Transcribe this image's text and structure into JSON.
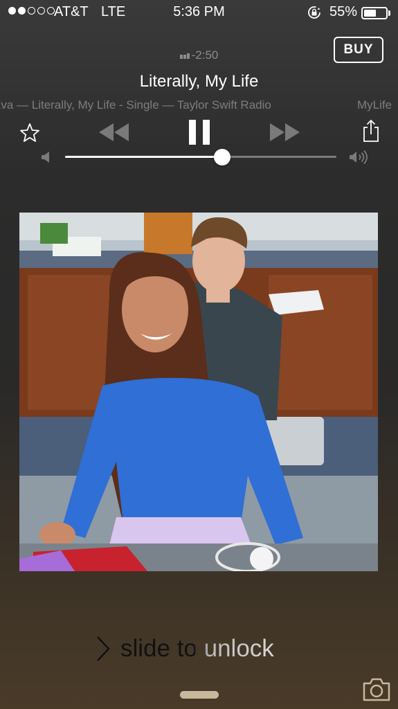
{
  "status_bar": {
    "signal_filled": 2,
    "signal_total": 5,
    "carrier": "AT&T",
    "network": "LTE",
    "time": "5:36 PM",
    "battery_percent_text": "55%",
    "battery_level": 0.55,
    "icons": [
      "orientation-lock-icon"
    ]
  },
  "now_playing": {
    "buy_label": "BUY",
    "time_remaining": "-2:50",
    "title": "Literally, My Life",
    "subtitle": "Eva — Literally, My Life - Single — Taylor Swift Radio",
    "subtitle_tail": "MyLife",
    "volume_level": 0.58
  },
  "controls": {
    "icons": [
      "star-icon",
      "rewind-icon",
      "pause-icon",
      "fast-forward-icon",
      "share-icon",
      "volume-low-icon",
      "volume-high-icon"
    ]
  },
  "lock_screen": {
    "slide_label": "slide to unlock",
    "icons": [
      "chevron-right-icon",
      "camera-icon"
    ]
  },
  "colors": {
    "background_top": "#3a3a3a",
    "background_bottom": "#4a3b28",
    "secondary_text": "#7d7d7d",
    "grabber": "#c8b89c",
    "sweater_blue": "#2f6fd6"
  }
}
